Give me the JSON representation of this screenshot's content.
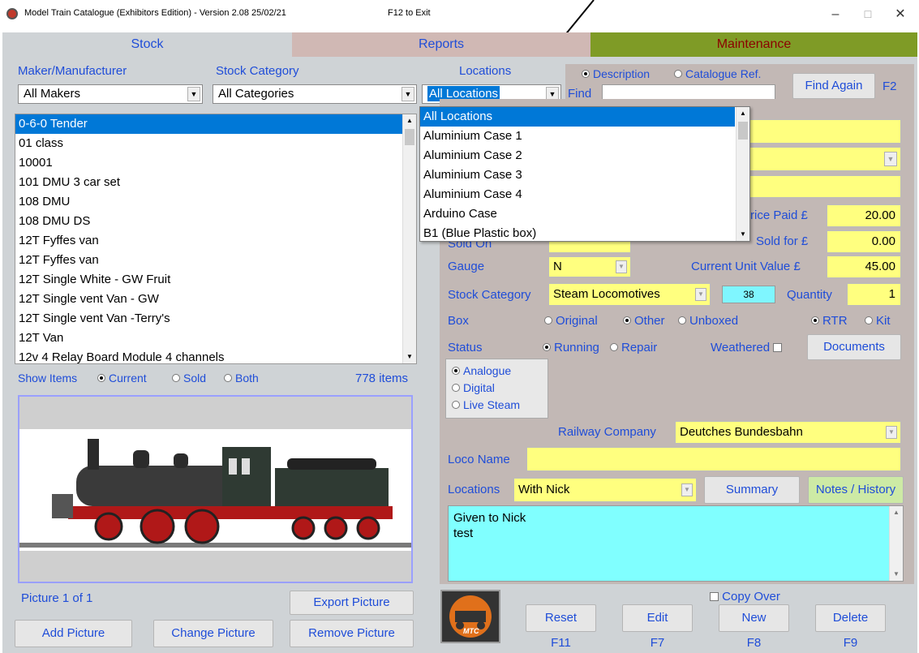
{
  "window": {
    "title": "Model Train Catalogue (Exhibitors Edition) - Version 2.08 25/02/21",
    "exit_hint": "F12 to Exit",
    "minimize": "–",
    "maximize": "☐",
    "close": "✕"
  },
  "tabs": {
    "stock": "Stock",
    "reports": "Reports",
    "maintenance": "Maintenance"
  },
  "filters": {
    "maker_label": "Maker/Manufacturer",
    "maker_value": "All Makers",
    "category_label": "Stock Category",
    "category_value": "All Categories",
    "locations_label": "Locations",
    "locations_value": "All Locations"
  },
  "search": {
    "mode_description": "Description",
    "mode_catalogue": "Catalogue Ref.",
    "find_label": "Find",
    "find_value": "",
    "find_again": "Find Again",
    "find_again_key": "F2"
  },
  "stock_list": {
    "items": [
      "0-6-0 Tender",
      "01 class",
      "10001",
      "101 DMU 3 car set",
      "108 DMU",
      "108 DMU DS",
      "12T Fyffes van",
      "12T Fyffes van",
      "12T Single White - GW Fruit",
      "12T Single vent Van - GW",
      "12T Single vent Van -Terry's",
      "12T Van",
      "12v 4 Relay Board Module 4 channels"
    ],
    "selected": "0-6-0 Tender"
  },
  "show_items": {
    "label": "Show Items",
    "current": "Current",
    "sold": "Sold",
    "both": "Both",
    "count": "778 items"
  },
  "locations_dropdown": {
    "options": [
      "All Locations",
      "Aluminium Case 1",
      "Aluminium Case 2",
      "Aluminium Case 3",
      "Aluminium Case 4",
      "Arduino Case",
      "B1 (Blue Plastic box)"
    ],
    "selected": "All Locations"
  },
  "picture": {
    "caption": "Picture 1 of 1",
    "export": "Export Picture",
    "add": "Add Picture",
    "change": "Change Picture",
    "remove": "Remove Picture"
  },
  "detail": {
    "price_paid_label": "rice Paid £",
    "price_paid": "20.00",
    "sold_on_label": "Sold On",
    "sold_for_label": "Sold for £",
    "sold_for": "0.00",
    "gauge_label": "Gauge",
    "gauge": "N",
    "current_value_label": "Current Unit Value £",
    "current_value": "45.00",
    "stock_category_label": "Stock Category",
    "stock_category": "Steam Locomotives",
    "category_code": "38",
    "quantity_label": "Quantity",
    "quantity": "1",
    "box_label": "Box",
    "box_original": "Original",
    "box_other": "Other",
    "box_unboxed": "Unboxed",
    "rtr": "RTR",
    "kit": "Kit",
    "status_label": "Status",
    "status_running": "Running",
    "status_repair": "Repair",
    "weathered_label": "Weathered",
    "documents": "Documents",
    "control_analogue": "Analogue",
    "control_digital": "Digital",
    "control_live_steam": "Live Steam",
    "railway_company_label": "Railway Company",
    "railway_company": "Deutches Bundesbahn",
    "loco_name_label": "Loco Name",
    "loco_name": "",
    "locations_label": "Locations",
    "locations": "With Nick",
    "summary": "Summary",
    "notes_history": "Notes / History",
    "notes_line1": "Given to Nick",
    "notes_line2": "test"
  },
  "actions": {
    "copy_over": "Copy Over",
    "reset": "Reset",
    "reset_key": "F11",
    "edit": "Edit",
    "edit_key": "F7",
    "new": "New",
    "new_key": "F8",
    "delete": "Delete",
    "delete_key": "F9",
    "logo_text": "MTC"
  }
}
